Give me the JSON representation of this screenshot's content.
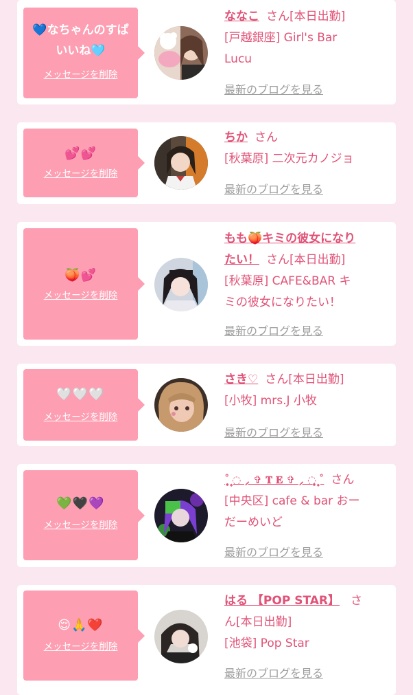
{
  "common": {
    "delete_label": "メッセージを削除",
    "blog_label": "最新のブログを見る",
    "san": "さん"
  },
  "colors": {
    "background": "#fbe7ef",
    "card": "#ffffff",
    "bubble": "#fd9eb2",
    "accent_text": "#e15277",
    "link_gray": "#9d9d9d"
  },
  "cards": [
    {
      "message_line1": "💙なちゃんのすぱ",
      "message_line2": "いいね🩵",
      "name": "ななこ",
      "status": "[本日出勤]",
      "shop_line1": "[戸越銀座] Girl's Bar",
      "shop_line2": "Lucu",
      "avatar_icon": "avatar-photo-icon"
    },
    {
      "message": "💕💕",
      "name": "ちか",
      "status": "",
      "shop_line1": "[秋葉原] 二次元カノジョ",
      "avatar_icon": "avatar-photo-icon"
    },
    {
      "message": "🍑💕",
      "name_line1": "もも🍑キミの彼女になり",
      "name_line2": "たい！",
      "status": "[本日出勤]",
      "shop_line1": "[秋葉原] CAFE&BAR キ",
      "shop_line2": "ミの彼女になりたい！",
      "avatar_icon": "avatar-photo-icon"
    },
    {
      "message": "🤍🤍🤍",
      "name": "さき♡",
      "status": "[本日出勤]",
      "shop_line1": "[小牧] mrs.J 小牧",
      "avatar_icon": "avatar-photo-icon"
    },
    {
      "message": "💚🖤💜",
      "name": "˚ ͙۪۪̥◌ ⸝ ✞ 𝐓 𝐄 ✞ ⸝ ◌ ͙۪۪̥˚",
      "status": "",
      "shop_line1": "[中央区] cafe & bar おー",
      "shop_line2": "だーめいど",
      "avatar_icon": "avatar-photo-icon"
    },
    {
      "message": "😌🙏❤️",
      "name": "はる 【POP STAR】",
      "san_line1": "さ",
      "san_line2": "ん[本日出勤]",
      "shop_line1": "[池袋] Pop Star",
      "avatar_icon": "avatar-photo-icon"
    }
  ]
}
